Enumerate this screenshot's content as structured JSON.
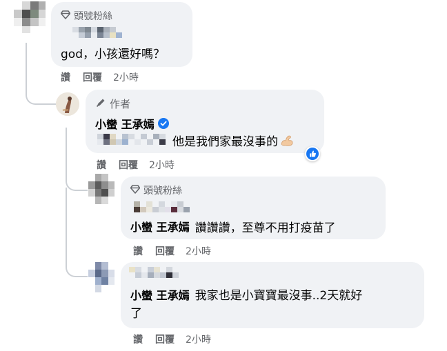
{
  "colors": {
    "bubble_bg": "#f0f2f5",
    "secondary_text": "#65676b",
    "verified_blue": "#1877f2",
    "thread_line": "#ccd0d5"
  },
  "comments": [
    {
      "badge_label": "頭號粉絲",
      "badge_icon": "diamond-icon",
      "text": "god，小孩還好嗎？",
      "actions": {
        "like": "讚",
        "reply": "回覆",
        "time": "2小時"
      }
    },
    {
      "badge_label": "作者",
      "badge_icon": "pen-icon",
      "author_name": "小蠻 王承嫣",
      "verified_icon": "verified-check-icon",
      "text": "他是我們家最沒事的",
      "emoji_icon": "flexed-biceps-icon",
      "reaction_icon": "like-reaction-icon",
      "actions": {
        "like": "讚",
        "reply": "回覆",
        "time": "2小時"
      }
    },
    {
      "badge_label": "頭號粉絲",
      "badge_icon": "diamond-icon",
      "mention": "小蠻 王承嫣",
      "text": "讚讚讚，至尊不用打疫苗了",
      "actions": {
        "like": "讚",
        "reply": "回覆",
        "time": "2小時"
      }
    },
    {
      "mention": "小蠻 王承嫣",
      "text_line1": "我家也是小寶寶最沒事..2天就好",
      "text_line2": "了",
      "actions": {
        "like": "讚",
        "reply": "回覆",
        "time": "2小時"
      }
    }
  ]
}
